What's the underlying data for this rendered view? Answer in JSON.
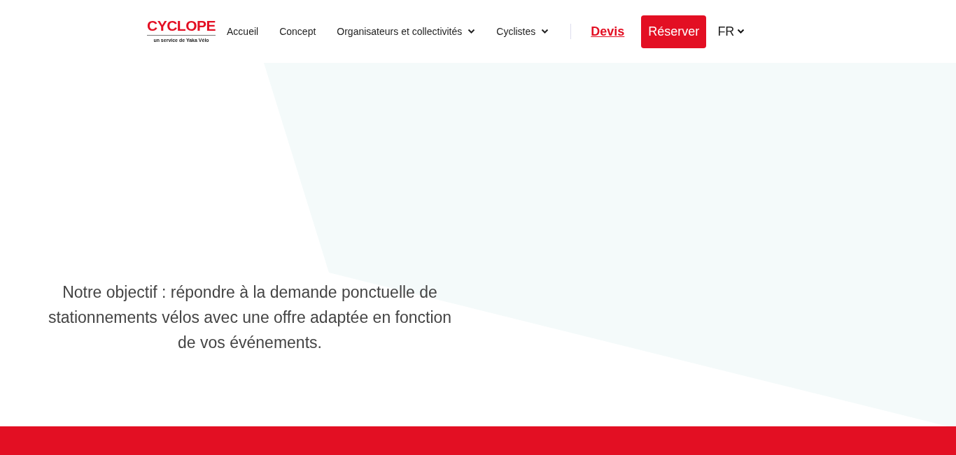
{
  "logo": {
    "name": "CYCLOPE",
    "tagline": "un service de Yaka Vélo"
  },
  "nav": [
    {
      "label": "Accueil",
      "kind": "link"
    },
    {
      "label": "Concept",
      "kind": "link"
    },
    {
      "label": "Organisateurs et collectivités",
      "kind": "dropdown"
    },
    {
      "label": "Cyclistes",
      "kind": "dropdown"
    }
  ],
  "quote_link": "Devis",
  "book_button": "Réserver",
  "language": "FR",
  "hero_text": "Notre objectif : répondre à la demande ponctuelle de stationnements vélos avec une offre adaptée en fonction de vos événements."
}
